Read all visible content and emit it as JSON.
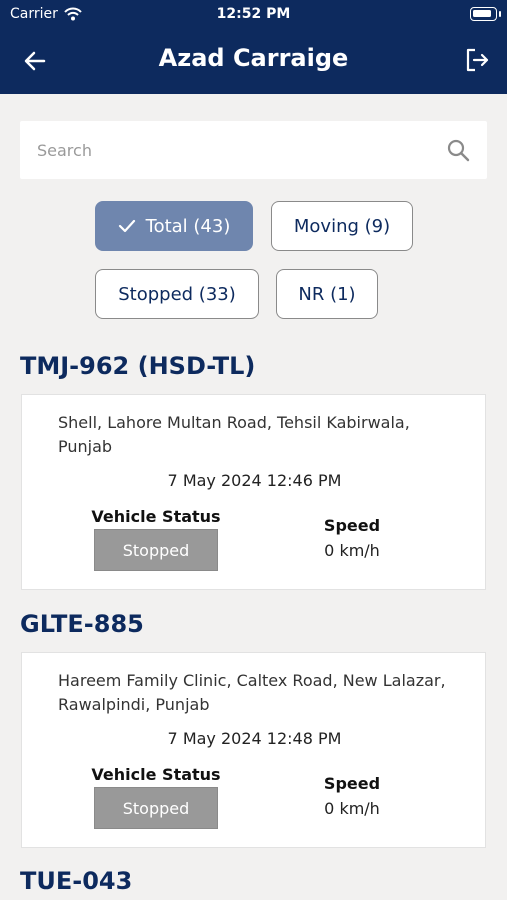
{
  "status_bar": {
    "carrier": "Carrier",
    "time": "12:52 PM"
  },
  "header": {
    "title": "Azad Carraige"
  },
  "search": {
    "placeholder": "Search"
  },
  "filters": [
    {
      "label": "Total (43)",
      "active": true
    },
    {
      "label": "Moving (9)",
      "active": false
    },
    {
      "label": "Stopped (33)",
      "active": false
    },
    {
      "label": "NR (1)",
      "active": false
    }
  ],
  "card_labels": {
    "status": "Vehicle Status",
    "speed": "Speed"
  },
  "vehicles": [
    {
      "name": "TMJ-962 (HSD-TL)",
      "address": "Shell, Lahore Multan Road, Tehsil Kabirwala, Punjab",
      "datetime": "7 May 2024 12:46 PM",
      "status": "Stopped",
      "speed": "0 km/h"
    },
    {
      "name": "GLTE-885",
      "address": "Hareem Family Clinic, Caltex Road, New Lalazar, Rawalpindi, Punjab",
      "datetime": "7 May 2024 12:48 PM",
      "status": "Stopped",
      "speed": "0 km/h"
    },
    {
      "name": "TUE-043"
    }
  ],
  "colors": {
    "header": "#0d2a5e",
    "chip_active": "#6f86ae",
    "status_stopped": "#999999",
    "background": "#f2f1f0"
  }
}
